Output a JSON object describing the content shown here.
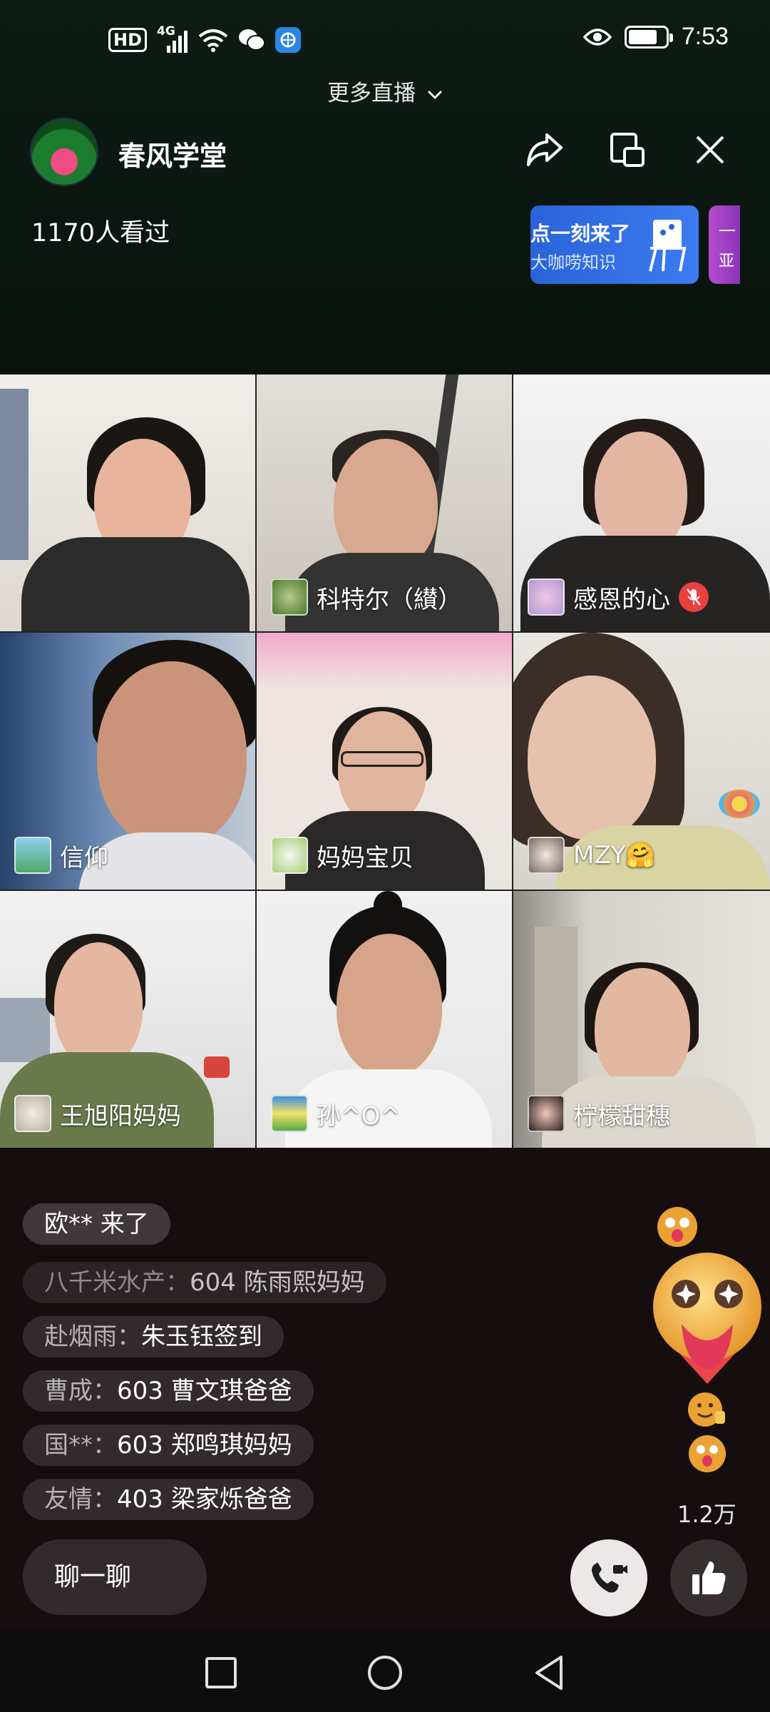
{
  "status_bar": {
    "hd": "HD",
    "network": "4G",
    "time": "7:53"
  },
  "header": {
    "more_live": "更多直播",
    "host_name": "春风学堂",
    "viewers": "1170人看过",
    "icons": [
      "share-icon",
      "floating-window-icon",
      "close-icon"
    ]
  },
  "banners": [
    {
      "line1": "点一刻来了",
      "line2": "大咖唠知识",
      "color": "#2f6fe4"
    },
    {
      "line1": "一",
      "line2": "亚",
      "color": "#a33fc5"
    }
  ],
  "participants": [
    {
      "name": "",
      "bg": "#e7e4df"
    },
    {
      "name": "科特尔（纉）",
      "bg": "#d9d6d1"
    },
    {
      "name": "感恩的心",
      "bg": "#eeeeee",
      "muted": true
    },
    {
      "name": "信仰",
      "bg": "#6d8ab3"
    },
    {
      "name": "妈妈宝贝",
      "bg": "#ede9e6"
    },
    {
      "name": "MZY🤗",
      "bg": "#e6e3e0"
    },
    {
      "name": "王旭阳妈妈",
      "bg": "#e8e8e8"
    },
    {
      "name": "孙^O^",
      "bg": "#eaeaea"
    },
    {
      "name": "柠檬甜穗",
      "bg": "#dcd9d4"
    }
  ],
  "comments": {
    "joined": "欧** 来了",
    "items": [
      {
        "user": "八千米水产：",
        "msg": "604 陈雨熙妈妈"
      },
      {
        "user": "赴烟雨：",
        "msg": "朱玉钰签到"
      },
      {
        "user": "曹成：",
        "msg": "603 曹文琪爸爸"
      },
      {
        "user": "国**：",
        "msg": "603 郑鸣琪妈妈"
      },
      {
        "user": "友情：",
        "msg": "403 梁家烁爸爸"
      }
    ]
  },
  "bottom": {
    "likes": "1.2万",
    "chat_placeholder": "聊一聊"
  },
  "nav": [
    "recent-apps-icon",
    "home-icon",
    "back-icon"
  ]
}
